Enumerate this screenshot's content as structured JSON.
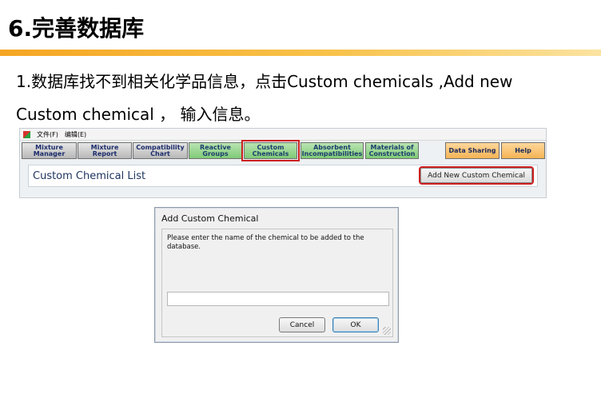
{
  "slide": {
    "title": "6.完善数据库",
    "line1": "1.数据库找不到相关化学品信息，点击Custom chemicals ,Add new",
    "line2": "Custom chemical ，  输入信息。"
  },
  "app": {
    "menu": [
      "文件(F)",
      "编辑(E)"
    ],
    "tabs": [
      {
        "label": "Mixture\nManager",
        "style": "gray"
      },
      {
        "label": "Mixture\nReport",
        "style": "gray"
      },
      {
        "label": "Compatibility\nChart",
        "style": "gray"
      },
      {
        "label": "Reactive\nGroups",
        "style": "green"
      },
      {
        "label": "Custom\nChemicals",
        "style": "green",
        "selected": true
      },
      {
        "label": "Absorbent\nIncompatibilities",
        "style": "green"
      },
      {
        "label": "Materials of\nConstruction",
        "style": "green"
      },
      {
        "label": "Data Sharing",
        "style": "orange"
      },
      {
        "label": "Help",
        "style": "orange"
      }
    ],
    "list_title": "Custom Chemical List",
    "add_button": "Add New Custom Chemical"
  },
  "dialog": {
    "title": "Add Custom Chemical",
    "message": "Please enter the name of the chemical to be added to the database.",
    "input_value": "",
    "cancel": "Cancel",
    "ok": "OK"
  },
  "colors": {
    "title_rule": "#f5a623",
    "highlight": "#cc1f1f",
    "tab_green": "#7fca77",
    "tab_orange": "#f5b455"
  }
}
